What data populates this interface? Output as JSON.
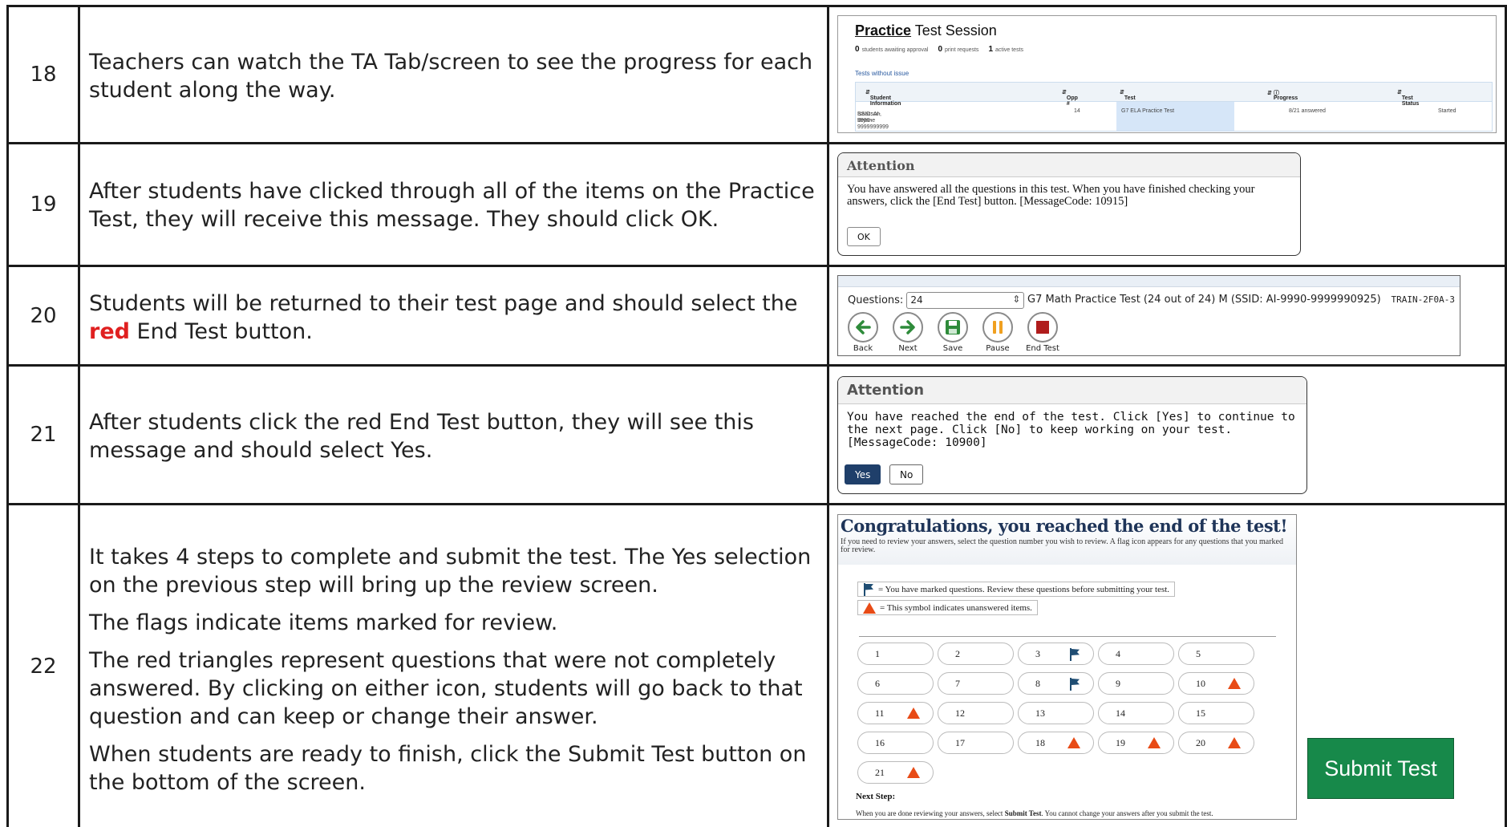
{
  "rows": [
    {
      "number": "18",
      "text": "Teachers can watch the TA Tab/screen to see the progress for each student along the way."
    },
    {
      "number": "19",
      "text": "After students have clicked through all of the items on the Practice Test, they will receive this message. They should click OK."
    },
    {
      "number": "20",
      "text_before": "Students will be returned to their test page and should select the",
      "highlight": "red",
      "text_after": " End Test button."
    },
    {
      "number": "21",
      "text": "After students click the red End Test button, they will see this message and should select Yes."
    },
    {
      "number": "22",
      "paragraphs": [
        "It takes 4 steps to complete and submit the test. The Yes selection on the previous step will bring up the review screen.",
        "The flags indicate items marked for review.",
        "The red triangles represent questions that were not completely answered. By clicking on either icon, students will go back to that question and can keep or change their answer.",
        "When students are ready to finish, click the Submit Test button on the bottom of the screen."
      ]
    }
  ],
  "ta_screen": {
    "title_bold": "Practice",
    "title_rest": " Test Session",
    "counts": [
      {
        "value": "0",
        "label": "students awaiting approval"
      },
      {
        "value": "0",
        "label": "print requests"
      },
      {
        "value": "1",
        "label": "active tests"
      }
    ],
    "subheading": "Tests without issue",
    "columns": [
      "Student Information",
      "Opp #",
      "Test",
      "Progress",
      "Test Status"
    ],
    "row": {
      "name": "Isaacson, Brynne",
      "ssid": "SSID: AI-9990-9999999999",
      "opp": "14",
      "test": "G7 ELA Practice Test",
      "progress": "8/21 answered",
      "status": "Started"
    }
  },
  "dialog_19": {
    "title": "Attention",
    "message": "You have answered all the questions in this test. When you have finished checking your answers, click the [End Test] button. [MessageCode: 10915]",
    "ok_label": "OK"
  },
  "toolbar_20": {
    "questions_label": "Questions:",
    "questions_value": "24",
    "test_info": "G7 Math Practice Test (24 out of 24)   M (SSID: AI-9990-9999990925)",
    "session_id": "TRAIN-2F0A-3",
    "buttons": [
      {
        "label": "Back",
        "icon": "arrow-left-icon",
        "color": "#2e8b3a"
      },
      {
        "label": "Next",
        "icon": "arrow-right-icon",
        "color": "#2e8b3a"
      },
      {
        "label": "Save",
        "icon": "save-icon",
        "color": "#2e8b3a"
      },
      {
        "label": "Pause",
        "icon": "pause-icon",
        "color": "#f0a020"
      },
      {
        "label": "End Test",
        "icon": "stop-icon",
        "color": "#b01c1c"
      }
    ]
  },
  "dialog_21": {
    "title": "Attention",
    "message": "You have reached the end of the test. Click [Yes] to continue to the next page. Click [No] to keep working on your test. [MessageCode: 10900]",
    "yes_label": "Yes",
    "no_label": "No"
  },
  "review_22": {
    "title": "Congratulations, you reached the end of the test!",
    "intro": "If you need to review your answers, select the question number you wish to review. A flag icon appears for any questions that you marked for review.",
    "legend_flag": "= You have marked questions. Review these questions before submitting your test.",
    "legend_triangle": "= This symbol indicates unanswered items.",
    "questions": [
      {
        "n": "1",
        "icon": ""
      },
      {
        "n": "2",
        "icon": ""
      },
      {
        "n": "3",
        "icon": "flag"
      },
      {
        "n": "4",
        "icon": ""
      },
      {
        "n": "5",
        "icon": ""
      },
      {
        "n": "6",
        "icon": ""
      },
      {
        "n": "7",
        "icon": ""
      },
      {
        "n": "8",
        "icon": "flag"
      },
      {
        "n": "9",
        "icon": ""
      },
      {
        "n": "10",
        "icon": "triangle"
      },
      {
        "n": "11",
        "icon": "triangle"
      },
      {
        "n": "12",
        "icon": ""
      },
      {
        "n": "13",
        "icon": ""
      },
      {
        "n": "14",
        "icon": ""
      },
      {
        "n": "15",
        "icon": ""
      },
      {
        "n": "16",
        "icon": ""
      },
      {
        "n": "17",
        "icon": ""
      },
      {
        "n": "18",
        "icon": "triangle"
      },
      {
        "n": "19",
        "icon": "triangle"
      },
      {
        "n": "20",
        "icon": "triangle"
      },
      {
        "n": "21",
        "icon": "triangle"
      }
    ],
    "next_step_label": "Next Step:",
    "next_step_text_a": "When you are done reviewing your answers, select ",
    "next_step_text_bold": "Submit Test",
    "next_step_text_b": ". You cannot change your answers after you submit the test."
  },
  "submit_label": "Submit Test",
  "colors": {
    "flag": "#1f4d73",
    "triangle": "#e84b16",
    "submit": "#17894a",
    "highlight_red": "#e02020"
  }
}
